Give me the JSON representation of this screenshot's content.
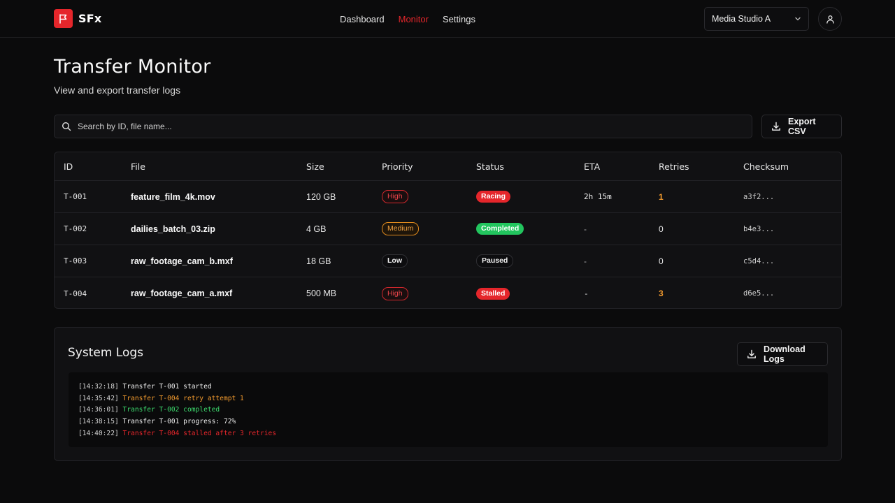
{
  "brand": {
    "name": "SFx",
    "accent": "#e5262b"
  },
  "nav": {
    "items": [
      {
        "label": "Dashboard",
        "active": false
      },
      {
        "label": "Monitor",
        "active": true
      },
      {
        "label": "Settings",
        "active": false
      }
    ]
  },
  "workspace": {
    "selected": "Media Studio A"
  },
  "page": {
    "title": "Transfer Monitor",
    "subtitle": "View and export transfer logs"
  },
  "search": {
    "placeholder": "Search by ID, file name...",
    "value": ""
  },
  "export": {
    "label": "Export CSV"
  },
  "table": {
    "columns": [
      "ID",
      "File",
      "Size",
      "Priority",
      "Status",
      "ETA",
      "Retries",
      "Checksum"
    ],
    "rows": [
      {
        "id": "T-001",
        "file": "feature_film_4k.mov",
        "size": "120 GB",
        "priority": "High",
        "status": "Racing",
        "eta": "2h 15m",
        "retries": "1",
        "checksum": "a3f2..."
      },
      {
        "id": "T-002",
        "file": "dailies_batch_03.zip",
        "size": "4 GB",
        "priority": "Medium",
        "status": "Completed",
        "eta": "-",
        "retries": "0",
        "checksum": "b4e3..."
      },
      {
        "id": "T-003",
        "file": "raw_footage_cam_b.mxf",
        "size": "18 GB",
        "priority": "Low",
        "status": "Paused",
        "eta": "-",
        "retries": "0",
        "checksum": "c5d4..."
      },
      {
        "id": "T-004",
        "file": "raw_footage_cam_a.mxf",
        "size": "500 MB",
        "priority": "High",
        "status": "Stalled",
        "eta": "-",
        "retries": "3",
        "checksum": "d6e5..."
      }
    ]
  },
  "logs": {
    "title": "System Logs",
    "download_label": "Download Logs",
    "entries": [
      {
        "ts": "[14:32:18]",
        "msg": "Transfer T-001 started",
        "level": "info"
      },
      {
        "ts": "[14:35:42]",
        "msg": "Transfer T-004 retry attempt 1",
        "level": "warn"
      },
      {
        "ts": "[14:36:01]",
        "msg": "Transfer T-002 completed",
        "level": "success"
      },
      {
        "ts": "[14:38:15]",
        "msg": "Transfer T-001 progress: 72%",
        "level": "info"
      },
      {
        "ts": "[14:40:22]",
        "msg": "Transfer T-004 stalled after 3 retries",
        "level": "error"
      }
    ]
  },
  "icons": [
    "flag-icon",
    "chevron-down-icon",
    "user-icon",
    "search-icon",
    "download-icon"
  ]
}
